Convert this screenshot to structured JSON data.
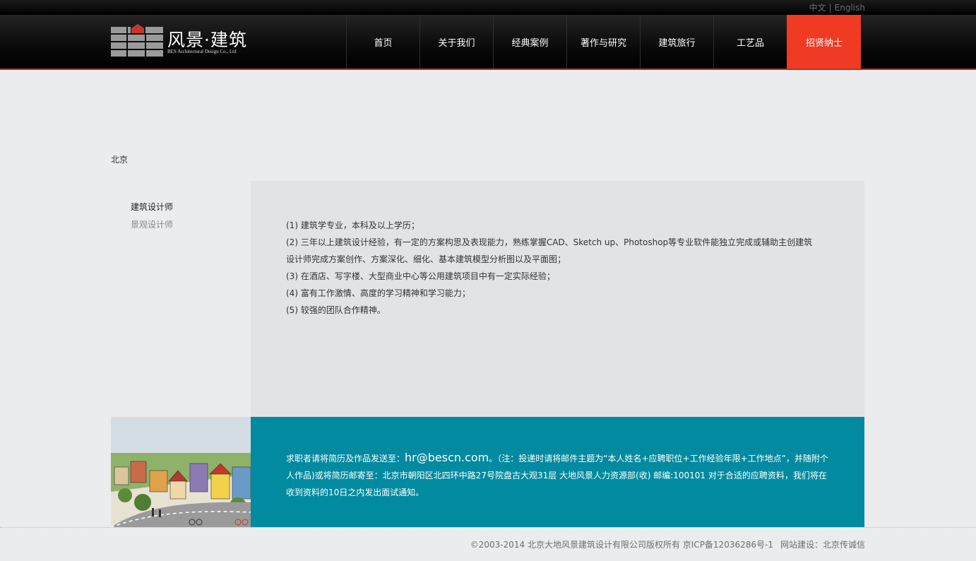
{
  "lang": {
    "zh": "中文",
    "separator": "|",
    "en": "English"
  },
  "logo": {
    "title": "风景·建筑",
    "subtitle": "BES Architectural Design Co., Ltd"
  },
  "nav": [
    {
      "label": "首页"
    },
    {
      "label": "关于我们"
    },
    {
      "label": "经典案例"
    },
    {
      "label": "著作与研究"
    },
    {
      "label": "建筑旅行"
    },
    {
      "label": "工艺品"
    },
    {
      "label": "招贤纳士"
    }
  ],
  "city": "北京",
  "sidebar": [
    {
      "label": "建筑设计师"
    },
    {
      "label": "景观设计师"
    }
  ],
  "requirements": [
    "(1) 建筑学专业，本科及以上学历；",
    "(2) 三年以上建筑设计经验，有一定的方案构思及表现能力，熟练掌握CAD、Sketch up、Photoshop等专业软件能独立完成或辅助主创建筑设计师完成方案创作、方案深化、细化、基本建筑模型分析图以及平面图；",
    "(3) 在酒店、写字楼、大型商业中心等公用建筑项目中有一定实际经验；",
    "(4) 富有工作激情、高度的学习精神和学习能力；",
    "(5) 较强的团队合作精神。"
  ],
  "contact": {
    "prefix": "求职者请将简历及作品发送至：",
    "email": "hr@bescn.com",
    "rest": "。（注：投递时请将邮件主题为“本人姓名+应聘职位+工作经验年限+工作地点”，并随附个人作品)或将简历邮寄至：北京市朝阳区北四环中路27号院盘古大观31层 大地风景人力资源部(收) 邮编:100101 对于合适的应聘资料，我们将在收到资料的10日之内发出面试通知。"
  },
  "footer": {
    "copyright": "©2003-2014 北京大地风景建筑设计有限公司版权所有 京ICP备12036286号-1",
    "credit": "网站建设：北京传诚信"
  },
  "colors": {
    "accent": "#f13a24",
    "teal": "#018aa0",
    "panel": "#e2e3e4",
    "background": "#ebecee"
  }
}
